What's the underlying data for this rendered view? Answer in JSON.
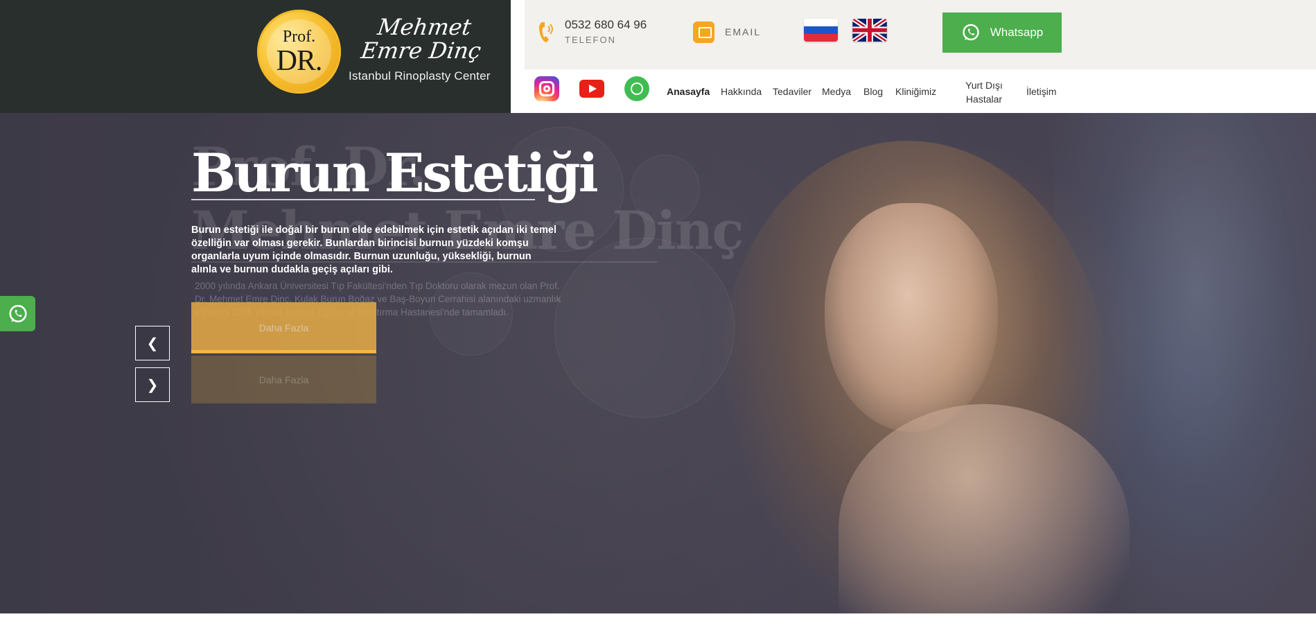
{
  "brand": {
    "logo_prof": "Prof.",
    "logo_dr": "DR.",
    "signature": "Mehmet Emre Dinç",
    "subtitle": "Istanbul Rinoplasty Center"
  },
  "contact": {
    "phone": "0532 680 64 96",
    "phone_label": "TELEFON",
    "email_label": "EMAIL",
    "whatsapp_label": "Whatsapp"
  },
  "nav": {
    "items": [
      {
        "label": "Anasayfa",
        "active": true
      },
      {
        "label": "Hakkında"
      },
      {
        "label": "Tedaviler"
      },
      {
        "label": "Medya"
      },
      {
        "label": "Blog"
      },
      {
        "label": "Kliniğimiz"
      },
      {
        "label": "Yurt Dışı Hastalar"
      },
      {
        "label": "İletişim"
      }
    ]
  },
  "hero": {
    "title": "Burun Estetiği",
    "text": "Burun estetiği ile doğal bir burun elde edebilmek için estetik açıdan iki temel özelliğin var olması gerekir. Bunlardan birincisi burnun yüzdeki komşu organlarla uyum içinde olmasıdır. Burnun uzunluğu, yüksekliği, burnun alınla ve burnun dudakla geçiş açıları gibi.",
    "button": "Daha Fazla",
    "ghost_title_1": "Prof. Dr.",
    "ghost_title_2": "Mehmet Emre Dinç",
    "ghost_text": "2000 yılında Ankara Üniversitesi Tıp Fakültesi'nden Tıp Doktoru olarak mezun olan Prof. Dr. Mehmet Emre Dinç, Kulak Burun Boğaz ve Baş-Boyun Cerrahisi alanındaki uzmanlık eğitimini 2005 yılında Ankara Eğitim ve Araştırma Hastanesi'nde tamamladı.",
    "ghost_button": "Daha Fazla",
    "prev": "❮",
    "next": "❯"
  },
  "colors": {
    "accent_orange": "#f5a623",
    "whatsapp_green": "#4cae4c",
    "header_dark": "#292f2c",
    "hero_bg": "#403c4a"
  },
  "icons": [
    "phone-icon",
    "mail-icon",
    "flag-ru-icon",
    "flag-uk-icon",
    "whatsapp-icon",
    "instagram-icon",
    "youtube-icon"
  ]
}
